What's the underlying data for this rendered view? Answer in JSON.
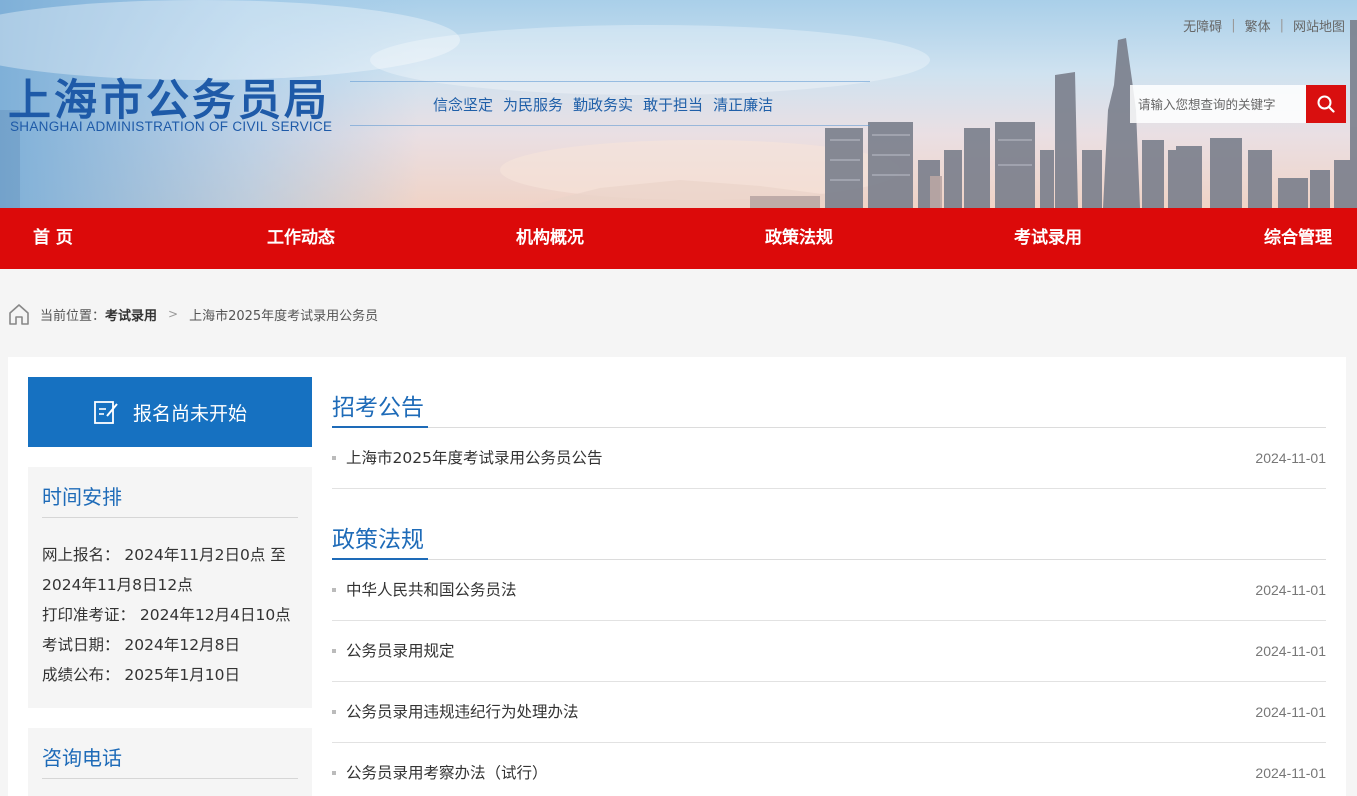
{
  "header": {
    "logo_cn": "上海市公务员局",
    "logo_en": "SHANGHAI ADMINISTRATION OF CIVIL SERVICE",
    "slogans": [
      "信念坚定",
      "为民服务",
      "勤政务实",
      "敢于担当",
      "清正廉洁"
    ],
    "top_links": [
      "无障碍",
      "繁体",
      "网站地图"
    ],
    "search": {
      "placeholder": "请输入您想查询的关键字",
      "icon": "search-icon"
    }
  },
  "nav": {
    "items": [
      "首 页",
      "工作动态",
      "机构概况",
      "政策法规",
      "考试录用",
      "综合管理"
    ]
  },
  "breadcrumb": {
    "prefix": "当前位置：",
    "section": "考试录用",
    "current": "上海市2025年度考试录用公务员"
  },
  "sidebar": {
    "status_label": "报名尚未开始",
    "status_icon": "edit-icon",
    "schedule": {
      "title": "时间安排",
      "lines": [
        "网上报名：  2024年11月2日0点 至",
        "2024年11月8日12点",
        "打印准考证：  2024年12月4日10点",
        "考试日期：  2024年12月8日",
        "成绩公布：  2025年1月10日"
      ]
    },
    "consult": {
      "title": "咨询电话"
    }
  },
  "main": {
    "sections": [
      {
        "title": "招考公告",
        "items": [
          {
            "title": "上海市2025年度考试录用公务员公告",
            "date": "2024-11-01"
          }
        ]
      },
      {
        "title": "政策法规",
        "items": [
          {
            "title": "中华人民共和国公务员法",
            "date": "2024-11-01"
          },
          {
            "title": "公务员录用规定",
            "date": "2024-11-01"
          },
          {
            "title": "公务员录用违规违纪行为处理办法",
            "date": "2024-11-01"
          },
          {
            "title": "公务员录用考察办法（试行）",
            "date": "2024-11-01"
          }
        ]
      }
    ]
  },
  "colors": {
    "nav_red": "#dc0a0a",
    "accent_blue": "#1e6bb8",
    "status_blue": "#1671c1"
  }
}
